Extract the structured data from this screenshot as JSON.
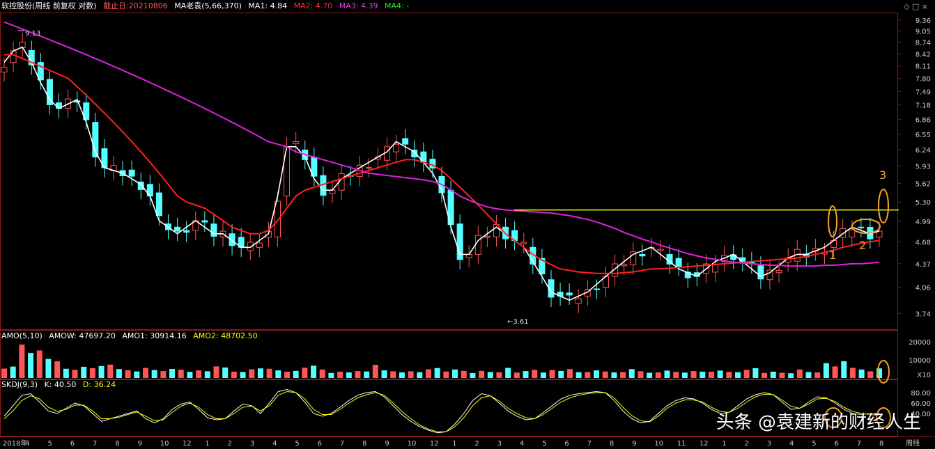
{
  "header": {
    "stock": "软控股份(周线 前复权 对数)",
    "cutoff": "截止日:20210806",
    "ma_name": "MA老袁(5,66,370)",
    "ma1": "MA1: 4.84",
    "ma2": "MA2: 4.70",
    "ma3": "MA3: 4.39",
    "ma4": "MA4: -",
    "ctrl": "◇ □ ×"
  },
  "amo_header": {
    "name": "AMO(5,10)",
    "amow": "AMOW: 47697.20",
    "amo1": "AMO1: 30914.16",
    "amo2": "AMO2: 48702.50"
  },
  "skdj_header": {
    "name": "SKDJ(9,3)",
    "k": "K: 40.50",
    "d": "D: 36.24"
  },
  "colors": {
    "up": "#ff5555",
    "down": "#54ffff",
    "ma1": "#ffffff",
    "ma2": "#ff2020",
    "ma3": "#e020e0",
    "k": "#ffffff",
    "d": "#ffff00",
    "level": "#ffff00",
    "mark": "#f5a623"
  },
  "chart_data": [
    {
      "type": "candlestick",
      "scale": "log",
      "ylim": [
        3.6,
        9.5
      ],
      "y_ticks": [
        "9.36",
        "9.05",
        "8.74",
        "8.42",
        "8.11",
        "7.80",
        "7.49",
        "7.18",
        "6.86",
        "6.55",
        "6.24",
        "5.93",
        "5.62",
        "5.30",
        "4.99",
        "4.68",
        "4.37",
        "4.06",
        "3.74"
      ],
      "x_ticks": [
        "2018年",
        "4",
        "5",
        "6",
        "7",
        "8",
        "9",
        "10",
        "12",
        "1",
        "2",
        "3",
        "4",
        "5",
        "6",
        "7",
        "8",
        "9",
        "10",
        "12",
        "1",
        "2",
        "3",
        "4",
        "5",
        "6",
        "7",
        "8",
        "9",
        "10",
        "11",
        "12",
        "1",
        "2",
        "3",
        "4",
        "5",
        "6",
        "7",
        "8",
        "周线"
      ],
      "max_label": "9.13",
      "min_label": "3.61",
      "resistance_level": 5.17,
      "mark_labels": [
        "1",
        "2",
        "3"
      ],
      "series": [
        {
          "name": "MA1",
          "values": [
            8.2,
            8.5,
            8.6,
            8.2,
            7.7,
            7.3,
            7.1,
            7.2,
            7.3,
            6.8,
            6.2,
            5.9,
            5.85,
            5.8,
            5.7,
            5.6,
            5.4,
            5.0,
            4.9,
            4.8,
            4.9,
            5.0,
            4.9,
            4.8,
            4.8,
            4.7,
            4.6,
            4.6,
            4.7,
            4.8,
            5.4,
            6.3,
            6.3,
            6.1,
            5.7,
            5.5,
            5.5,
            5.7,
            5.8,
            5.9,
            6.0,
            6.1,
            6.2,
            6.4,
            6.3,
            6.2,
            6.0,
            5.8,
            5.5,
            4.9,
            4.5,
            4.5,
            4.7,
            4.8,
            4.9,
            4.8,
            4.7,
            4.6,
            4.4,
            4.2,
            4.0,
            3.95,
            3.9,
            3.95,
            4.0,
            4.1,
            4.2,
            4.3,
            4.4,
            4.5,
            4.55,
            4.6,
            4.5,
            4.4,
            4.3,
            4.25,
            4.2,
            4.3,
            4.4,
            4.45,
            4.5,
            4.4,
            4.3,
            4.2,
            4.25,
            4.35,
            4.45,
            4.5,
            4.5,
            4.55,
            4.6,
            4.7,
            4.8,
            4.9,
            4.85,
            4.8,
            4.84
          ]
        },
        {
          "name": "MA2",
          "values": [
            8.4,
            8.4,
            8.3,
            8.2,
            8.1,
            8.0,
            7.9,
            7.8,
            7.6,
            7.4,
            7.2,
            7.0,
            6.8,
            6.6,
            6.4,
            6.2,
            6.0,
            5.8,
            5.6,
            5.4,
            5.3,
            5.25,
            5.2,
            5.1,
            5.0,
            4.9,
            4.85,
            4.8,
            4.8,
            4.85,
            5.0,
            5.2,
            5.4,
            5.5,
            5.55,
            5.6,
            5.65,
            5.7,
            5.75,
            5.8,
            5.85,
            5.9,
            5.95,
            6.0,
            6.05,
            6.05,
            6.0,
            5.95,
            5.85,
            5.7,
            5.55,
            5.4,
            5.25,
            5.1,
            4.95,
            4.8,
            4.7,
            4.6,
            4.5,
            4.42,
            4.36,
            4.3,
            4.28,
            4.26,
            4.25,
            4.24,
            4.24,
            4.24,
            4.25,
            4.26,
            4.28,
            4.3,
            4.3,
            4.31,
            4.32,
            4.33,
            4.34,
            4.35,
            4.36,
            4.37,
            4.38,
            4.39,
            4.4,
            4.41,
            4.42,
            4.43,
            4.44,
            4.45,
            4.47,
            4.5,
            4.53,
            4.56,
            4.6,
            4.63,
            4.66,
            4.68,
            4.7
          ]
        },
        {
          "name": "MA3",
          "values": [
            9.3,
            9.2,
            9.1,
            9.0,
            8.9,
            8.8,
            8.7,
            8.6,
            8.5,
            8.4,
            8.3,
            8.2,
            8.1,
            8.0,
            7.9,
            7.8,
            7.7,
            7.6,
            7.5,
            7.4,
            7.3,
            7.2,
            7.1,
            7.0,
            6.9,
            6.8,
            6.7,
            6.6,
            6.5,
            6.4,
            6.35,
            6.3,
            6.2,
            6.15,
            6.1,
            6.05,
            6.0,
            5.95,
            5.9,
            5.85,
            5.8,
            5.78,
            5.76,
            5.74,
            5.72,
            5.7,
            5.68,
            5.65,
            5.6,
            5.5,
            5.4,
            5.33,
            5.27,
            5.22,
            5.19,
            5.17,
            5.16,
            5.15,
            5.14,
            5.13,
            5.12,
            5.1,
            5.08,
            5.05,
            5.02,
            4.98,
            4.93,
            4.88,
            4.82,
            4.77,
            4.72,
            4.68,
            4.63,
            4.59,
            4.55,
            4.51,
            4.48,
            4.45,
            4.43,
            4.41,
            4.39,
            4.38,
            4.37,
            4.36,
            4.35,
            4.35,
            4.34,
            4.34,
            4.34,
            4.34,
            4.35,
            4.35,
            4.36,
            4.37,
            4.37,
            4.38,
            4.39
          ]
        }
      ]
    },
    {
      "type": "bar",
      "ylim": [
        0,
        25000
      ],
      "y_ticks": [
        "20000",
        "10000",
        "X10"
      ],
      "values": [
        5200,
        6300,
        18500,
        13800,
        15200,
        10500,
        9200,
        5100,
        4500,
        6200,
        5400,
        6600,
        7400,
        4900,
        4300,
        3600,
        5600,
        4400,
        3800,
        5000,
        4600,
        3400,
        4200,
        3700,
        6400,
        5800,
        3500,
        3300,
        4800,
        5300,
        5100,
        4200,
        3500,
        3900,
        5700,
        6800,
        4700,
        2800,
        3500,
        3100,
        3800,
        3600,
        7300,
        4200,
        3700,
        3100,
        3700,
        3200,
        4800,
        5500,
        3600,
        4700,
        3900,
        2700,
        3900,
        3300,
        3200,
        5600,
        3000,
        3800,
        4500,
        3000,
        4400,
        3900,
        4900,
        3200,
        3300,
        4200,
        3600,
        3100,
        3300,
        4900,
        3700,
        2900,
        3100,
        4100,
        3400,
        3000,
        3800,
        3500,
        3500,
        4100,
        3400,
        3200,
        4500,
        5400,
        2800,
        3500,
        2900,
        2600,
        4700,
        3300,
        3100,
        8200,
        6400,
        9300,
        5600,
        4700,
        3700,
        5300
      ]
    },
    {
      "type": "line",
      "ylim": [
        0,
        100
      ],
      "y_ticks": [
        "80.00",
        "60.00",
        "40.00"
      ],
      "series": [
        {
          "name": "K",
          "values": [
            35,
            55,
            75,
            78,
            62,
            45,
            40,
            50,
            60,
            55,
            40,
            25,
            30,
            35,
            40,
            45,
            30,
            22,
            30,
            48,
            58,
            62,
            48,
            32,
            28,
            30,
            45,
            58,
            55,
            40,
            60,
            82,
            86,
            80,
            62,
            40,
            35,
            40,
            52,
            65,
            75,
            80,
            82,
            72,
            55,
            38,
            25,
            15,
            8,
            3,
            5,
            20,
            40,
            65,
            78,
            74,
            60,
            45,
            35,
            28,
            30,
            42,
            55,
            68,
            75,
            78,
            80,
            82,
            80,
            65,
            45,
            30,
            22,
            25,
            40,
            55,
            65,
            70,
            68,
            60,
            48,
            40,
            42,
            55,
            68,
            76,
            80,
            76,
            62,
            48,
            50,
            62,
            72,
            70,
            60,
            48,
            40,
            38,
            40,
            40
          ]
        },
        {
          "name": "D",
          "values": [
            30,
            45,
            65,
            74,
            68,
            52,
            44,
            48,
            56,
            56,
            45,
            30,
            30,
            33,
            38,
            43,
            35,
            26,
            28,
            42,
            54,
            60,
            52,
            38,
            30,
            30,
            40,
            52,
            54,
            45,
            55,
            75,
            82,
            80,
            68,
            48,
            38,
            38,
            48,
            60,
            70,
            76,
            80,
            75,
            60,
            44,
            30,
            18,
            10,
            5,
            5,
            15,
            32,
            55,
            70,
            74,
            64,
            50,
            40,
            32,
            30,
            38,
            50,
            62,
            70,
            75,
            78,
            80,
            80,
            70,
            52,
            36,
            26,
            24,
            35,
            50,
            60,
            66,
            66,
            62,
            52,
            44,
            42,
            50,
            62,
            72,
            77,
            76,
            66,
            54,
            50,
            58,
            68,
            69,
            63,
            52,
            44,
            40,
            38,
            36
          ]
        }
      ]
    }
  ]
}
